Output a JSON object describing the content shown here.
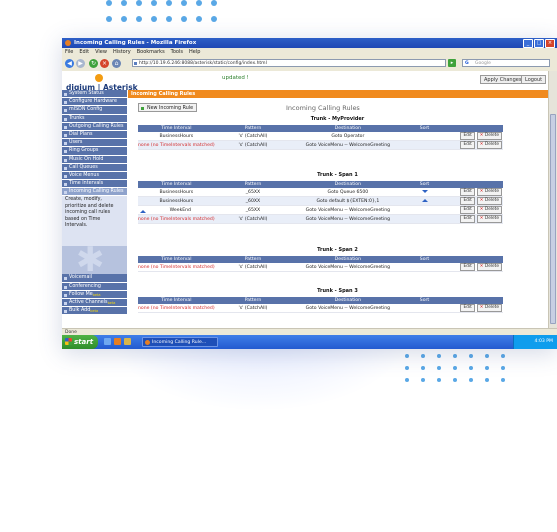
{
  "window": {
    "title": "Incoming Calling Rules - Mozilla Firefox"
  },
  "menu": [
    "File",
    "Edit",
    "View",
    "History",
    "Bookmarks",
    "Tools",
    "Help"
  ],
  "address": {
    "url": "http://10.19.6.246:8088/asterisk/static/config/index.html",
    "search_placeholder": "Google"
  },
  "app": {
    "logo": "digium | Asterisk",
    "updated": "updated !",
    "apply_changes": "Apply Changes",
    "logout": "Logout",
    "section_header": "Incoming Calling Rules"
  },
  "sidebar": {
    "items_top": [
      "System Status",
      "Configure Hardware",
      "mISDN Config",
      "Trunks",
      "Outgoing Calling Rules",
      "Dial Plans",
      "Users",
      "Ring Groups",
      "Music On Hold",
      "Call Queues",
      "Voice Menus",
      "Time Intervals",
      "Incoming Calling Rules"
    ],
    "description": "Create, modify, prioritize and delete incoming call rules based on Time Intervals.",
    "items_bottom": [
      "Voicemail",
      "Conferencing",
      "Follow Me",
      "Active Channels",
      "Bulk Add"
    ],
    "beta_label": "beta"
  },
  "content": {
    "new_rule_button": "New Incoming Rule",
    "page_title": "Incoming Calling Rules",
    "columns": [
      "Time Interval",
      "Pattern",
      "Destination",
      "Sort"
    ],
    "edit_label": "Edit",
    "delete_label": "Delete",
    "trunks": [
      {
        "title": "Trunk - MyProvider",
        "rows": [
          {
            "interval": "BusinessHours",
            "pattern": "'s' (CatchAll)",
            "destination": "Goto Operator",
            "sort_up": false,
            "sort_down": false,
            "red": false
          },
          {
            "interval": "none (no TimeIntervals matched)",
            "pattern": "'s' (CatchAll)",
            "destination": "Goto VoiceMenu -- WelcomeGreeting",
            "sort_up": false,
            "sort_down": false,
            "red": true
          }
        ]
      },
      {
        "title": "Trunk - Span 1",
        "rows": [
          {
            "interval": "BusinessHours",
            "pattern": "_65XX",
            "destination": "Goto Queue 6500",
            "sort_up": false,
            "sort_down": true,
            "red": false
          },
          {
            "interval": "BusinessHours",
            "pattern": "_60XX",
            "destination": "Goto default ${EXTEN:0},1",
            "sort_up": true,
            "sort_down": false,
            "red": false
          },
          {
            "interval": "WeekEnd",
            "pattern": "_65XX",
            "destination": "Goto VoiceMenu -- WelcomeGreeting",
            "sort_up": false,
            "sort_down": false,
            "red": false,
            "left_arrow": true
          },
          {
            "interval": "none (no TimeIntervals matched)",
            "pattern": "'s' (CatchAll)",
            "destination": "Goto VoiceMenu -- WelcomeGreeting",
            "sort_up": false,
            "sort_down": false,
            "red": true
          }
        ]
      },
      {
        "title": "Trunk - Span 2",
        "rows": [
          {
            "interval": "none (no TimeIntervals matched)",
            "pattern": "'s' (CatchAll)",
            "destination": "Goto VoiceMenu -- WelcomeGreeting",
            "sort_up": false,
            "sort_down": false,
            "red": true
          }
        ]
      },
      {
        "title": "Trunk - Span 3",
        "rows": [
          {
            "interval": "none (no TimeIntervals matched)",
            "pattern": "'s' (CatchAll)",
            "destination": "Goto VoiceMenu -- WelcomeGreeting",
            "sort_up": false,
            "sort_down": false,
            "red": true
          }
        ]
      }
    ]
  },
  "statusbar": {
    "text": "Done"
  },
  "taskbar": {
    "start": "start",
    "task": "Incoming Calling Rule...",
    "clock": "4:03 PM"
  },
  "colors": {
    "nav_blue": "#5872a9",
    "orange": "#f08a1e",
    "red_text": "#d42a2a",
    "dots": "#5aa8e6"
  }
}
